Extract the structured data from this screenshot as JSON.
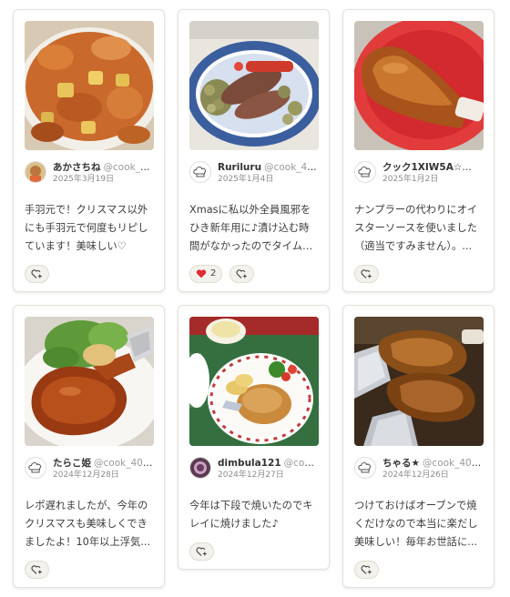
{
  "cards": [
    {
      "author": "あかさちね",
      "handle": "@cook_4...",
      "date": "2025年3月19日",
      "comment": "手羽元で！クリスマス以外にも手羽元で何度もリピしています！美味しい♡"
    },
    {
      "author": "Ruriluru",
      "handle": "@cook_40...",
      "date": "2025年1月4日",
      "comment": "Xmasに私以外全員風邪をひき新年用に♪漬け込む時間がなかったのでタイムと...",
      "reaction": {
        "emoji": "❤️",
        "count": "2"
      }
    },
    {
      "author": "クック1XIW5A☆",
      "handle": "@c...",
      "date": "2025年1月2日",
      "comment": "ナンプラーの代わりにオイスターソースを使いました（適当ですみません）。..."
    },
    {
      "author": "たらこ姫",
      "handle": "@cook_405...",
      "date": "2024年12月28日",
      "comment": "レポ遅れましたが、今年のクリスマスも美味しくできましたよ！10年以上浮気..."
    },
    {
      "author": "dimbula121",
      "handle": "@cook...",
      "date": "2024年12月27日",
      "comment": "今年は下段で焼いたのでキレイに焼けました♪"
    },
    {
      "author": "ちゃる★",
      "handle": "@cook_405...",
      "date": "2024年12月26日",
      "comment": "つけておけばオーブンで焼くだけなので本当に楽だし美味しい！毎年お世話に..."
    }
  ],
  "icons": {
    "avatar_default": "chef-hat-icon",
    "add_reaction": "heart-plus-icon"
  },
  "colors": {
    "card_border": "#e4e2da",
    "pill_bg": "#f4f2ec",
    "text_muted": "#9a9a9a"
  }
}
